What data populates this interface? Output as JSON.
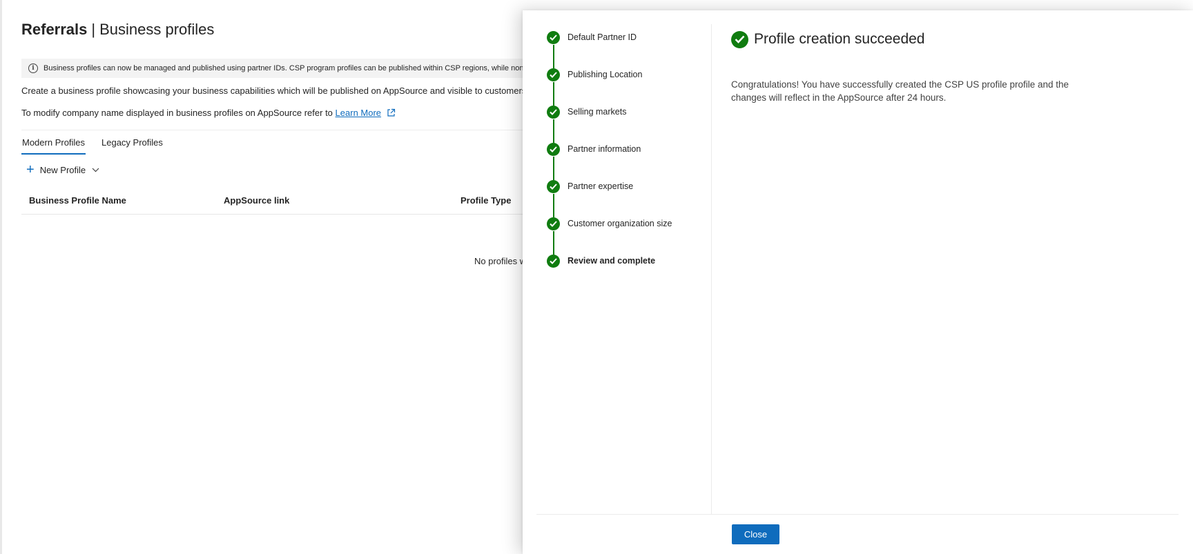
{
  "header": {
    "title_strong": "Referrals",
    "separator": "|",
    "title_rest": "Business profiles"
  },
  "info_banner": {
    "text": "Business profiles can now be managed and published using partner IDs. CSP program profiles can be published within CSP regions, while non-CSP"
  },
  "description": {
    "line1": "Create a business profile showcasing your business capabilities which will be published on AppSource and visible to customers to re",
    "line2_prefix": "To modify company name displayed in business profiles on AppSource refer to",
    "learn_more": "Learn More"
  },
  "tabs": [
    {
      "label": "Modern Profiles",
      "selected": true
    },
    {
      "label": "Legacy Profiles",
      "selected": false
    }
  ],
  "toolbar": {
    "new_profile_label": "New Profile"
  },
  "table": {
    "columns": [
      "Business Profile Name",
      "AppSource link",
      "Profile Type"
    ],
    "empty_message": "No profiles w"
  },
  "panel": {
    "steps": [
      {
        "label": "Default Partner ID",
        "status": "complete"
      },
      {
        "label": "Publishing Location",
        "status": "complete"
      },
      {
        "label": "Selling markets",
        "status": "complete"
      },
      {
        "label": "Partner information",
        "status": "complete"
      },
      {
        "label": "Partner expertise",
        "status": "complete"
      },
      {
        "label": "Customer organization size",
        "status": "complete"
      },
      {
        "label": "Review and complete",
        "status": "complete",
        "current": true
      }
    ],
    "success_title": "Profile creation succeeded",
    "success_message": "Congratulations! You have successfully created the CSP US profile profile and the changes will reflect in the AppSource after 24 hours.",
    "close_label": "Close"
  },
  "colors": {
    "success_green": "#107c10",
    "brand_blue": "#0f6cbd",
    "text": "#242424"
  },
  "icons": {
    "info": "info-icon",
    "external_link": "external-link-icon",
    "add": "plus-icon",
    "dropdown": "chevron-down-icon",
    "step_done": "checkmark-circle-icon"
  }
}
